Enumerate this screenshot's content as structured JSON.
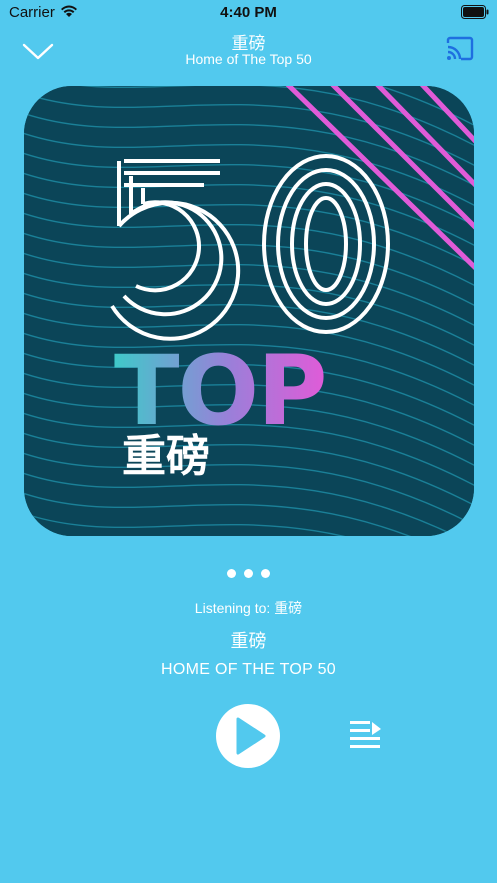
{
  "status_bar": {
    "carrier": "Carrier",
    "time": "4:40 PM"
  },
  "nav": {
    "title": "重磅",
    "subtitle": "Home of The Top 50"
  },
  "artwork": {
    "number": "50",
    "word": "TOP",
    "chinese": "重磅"
  },
  "page_indicator": {
    "count": 3,
    "active_index": 0
  },
  "info": {
    "listening_label": "Listening to:",
    "listening_station": "重磅",
    "station_name": "重磅",
    "station_desc": "HOME OF THE TOP 50"
  },
  "colors": {
    "background": "#52C9EE",
    "artwork_bg": "#0B4558",
    "accent_teal": "#3FC9C9",
    "accent_pink": "#E05BD8"
  },
  "icons": {
    "back": "chevron-down-icon",
    "cast": "cast-icon",
    "play": "play-icon",
    "queue": "queue-icon"
  }
}
